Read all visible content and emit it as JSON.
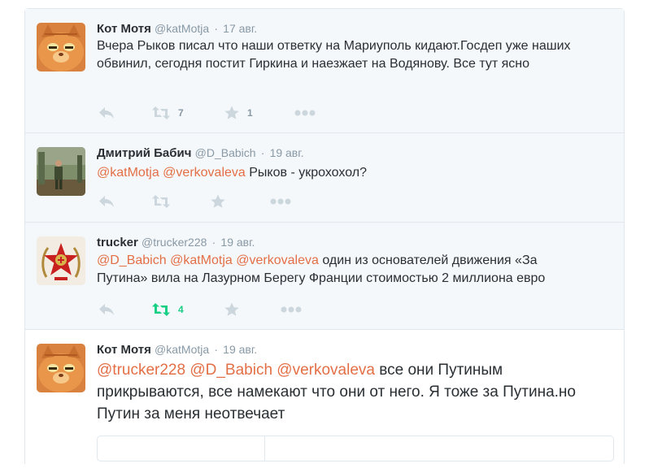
{
  "colors": {
    "mention": "#e36f47",
    "meta": "#8899a6",
    "text": "#292f33",
    "icon": "#ccd6dd",
    "retweeted": "#19cf86",
    "border": "#e1e8ed",
    "reply_bg": "#f5f8fa"
  },
  "tweets": [
    {
      "fullname": "Кот Мотя",
      "username": "@katMotja",
      "sep": "·",
      "time": "17 авг.",
      "text": "Вчера Рыков писал что наши ответку на Мариуполь кидают.Госдеп уже наших обвинил, сегодня постит Гиркина и наезжает на Водянову. Все тут ясно",
      "retweets": "7",
      "favorites": "1",
      "avatar": "cat-avatar"
    },
    {
      "fullname": "Дмитрий Бабич",
      "username": "@D_Babich",
      "sep": "·",
      "time": "19 авг.",
      "mentions": [
        "@katMotja",
        "@verkovaleva"
      ],
      "text": "Рыков - укрохохол?",
      "avatar": "soldier-photo-avatar"
    },
    {
      "fullname": "trucker",
      "username": "@trucker228",
      "sep": "·",
      "time": "19 авг.",
      "mentions": [
        "@D_Babich",
        "@katMotja",
        "@verkovaleva"
      ],
      "text_line1": "один из основателей движения «За",
      "text_line2": "Путина» вила на Лазурном Берегу Франции стоимостью 2 миллиона евро",
      "retweets": "4",
      "avatar": "red-star-emblem-avatar"
    },
    {
      "fullname": "Кот Мотя",
      "username": "@katMotja",
      "sep": "·",
      "time": "19 авг.",
      "mentions": [
        "@trucker228",
        "@D_Babich",
        "@verkovaleva"
      ],
      "text_line1": "все они Путиным",
      "text_line2": "прикрываются, все намекают что они от него. Я  тоже за Путина.но",
      "text_line3": "Путин за меня неотвечает",
      "avatar": "cat-avatar"
    }
  ]
}
